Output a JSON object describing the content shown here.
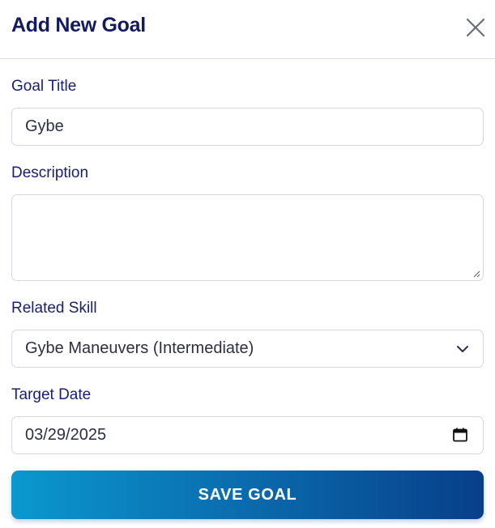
{
  "dialog": {
    "title": "Add New Goal",
    "close_icon": "close-icon"
  },
  "form": {
    "goal_title": {
      "label": "Goal Title",
      "value": "Gybe"
    },
    "description": {
      "label": "Description",
      "value": ""
    },
    "related_skill": {
      "label": "Related Skill",
      "selected": "Gybe Maneuvers (Intermediate)",
      "icon": "chevron-down-icon"
    },
    "target_date": {
      "label": "Target Date",
      "value": "03/29/2025",
      "icon": "calendar-icon"
    }
  },
  "actions": {
    "save_label": "SAVE GOAL"
  },
  "colors": {
    "title": "#141a5e",
    "label": "#1a2070",
    "border": "#d5d7de",
    "button_gradient_start": "#0a98cf",
    "button_gradient_end": "#083f8a"
  }
}
